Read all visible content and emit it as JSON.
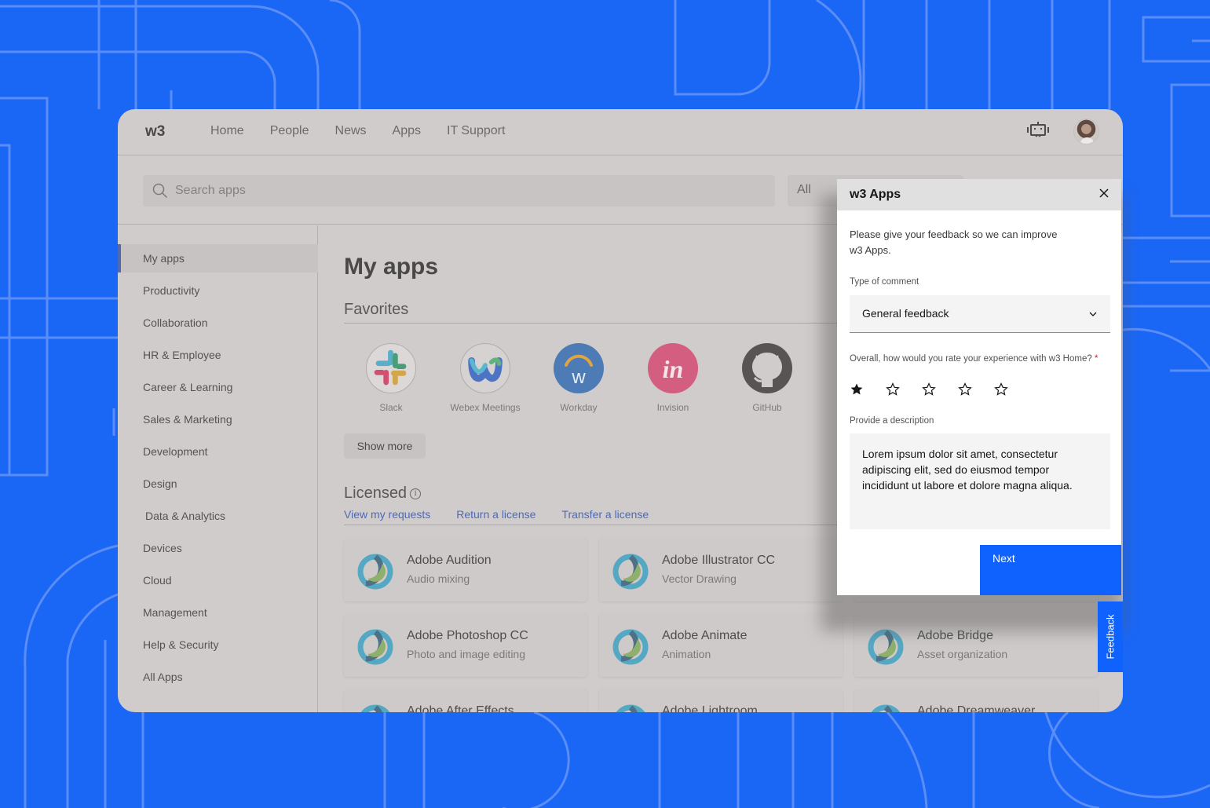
{
  "colors": {
    "background": "#1a66f5",
    "primary": "#0f62fe",
    "link": "#4b6ab8",
    "active_indicator": "#4f69b2",
    "required": "#da1e28"
  },
  "topnav": {
    "brand": "w3",
    "links": [
      "Home",
      "People",
      "News",
      "Apps",
      "IT Support"
    ],
    "icons": [
      "chatbot-icon",
      "user-avatar"
    ]
  },
  "search": {
    "placeholder": "Search apps",
    "filter_value": "All"
  },
  "sidebar": {
    "items": [
      {
        "label": "My apps",
        "active": true
      },
      {
        "label": "Productivity"
      },
      {
        "label": "Collaboration"
      },
      {
        "label": "HR & Employee"
      },
      {
        "label": "Career & Learning"
      },
      {
        "label": "Sales & Marketing"
      },
      {
        "label": "Development"
      },
      {
        "label": "Design"
      },
      {
        "label": "Data & Analytics"
      },
      {
        "label": "Devices"
      },
      {
        "label": "Cloud"
      },
      {
        "label": "Management"
      },
      {
        "label": "Help & Security"
      },
      {
        "label": "All Apps"
      }
    ]
  },
  "main": {
    "title": "My apps",
    "favorites": {
      "heading": "Favorites",
      "apps": [
        {
          "name": "Slack",
          "icon": "slack-logo"
        },
        {
          "name": "Webex Meetings",
          "icon": "webex-logo"
        },
        {
          "name": "Workday",
          "icon": "workday-logo"
        },
        {
          "name": "Invision",
          "icon": "invision-logo"
        },
        {
          "name": "GitHub",
          "icon": "github-logo"
        }
      ],
      "show_more": "Show more"
    },
    "licensed": {
      "heading": "Licensed",
      "links": [
        "View my requests",
        "Return a license",
        "Transfer a license"
      ],
      "apps": [
        {
          "name": "Adobe Audition",
          "description": "Audio mixing"
        },
        {
          "name": "Adobe Illustrator CC",
          "description": "Vector Drawing"
        },
        {
          "name": "",
          "description": ""
        },
        {
          "name": "Adobe Photoshop CC",
          "description": "Photo and image editing"
        },
        {
          "name": "Adobe Animate",
          "description": "Animation"
        },
        {
          "name": "Adobe Bridge",
          "description": "Asset organization"
        },
        {
          "name": "Adobe After Effects",
          "description": ""
        },
        {
          "name": "Adobe Lightroom",
          "description": ""
        },
        {
          "name": "Adobe Dreamweaver",
          "description": ""
        }
      ]
    }
  },
  "feedback_modal": {
    "title": "w3 Apps",
    "intro": "Please give your feedback so we can improve w3 Apps.",
    "type_label": "Type of comment",
    "type_value": "General feedback",
    "rating_label": "Overall, how would you rate your experience with w3 Home?",
    "rating_required_mark": "*",
    "rating_value": 1,
    "rating_max": 5,
    "description_label": "Provide a description",
    "description_value": "Lorem ipsum dolor sit amet, consectetur adipiscing elit, sed do eiusmod tempor incididunt ut labore et dolore magna aliqua.",
    "next_label": "Next"
  },
  "feedback_tab": {
    "label": "Feedback"
  }
}
